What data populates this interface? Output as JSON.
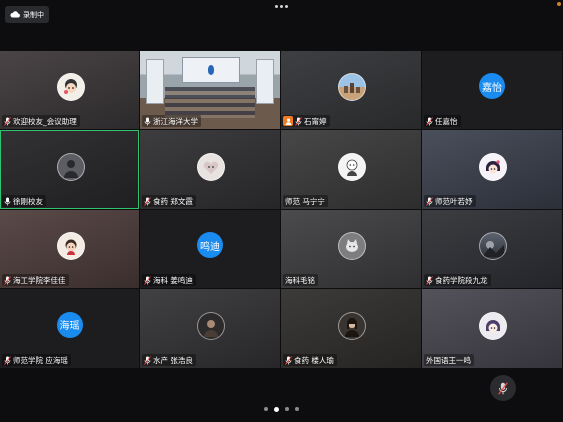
{
  "recording": {
    "label": "录制中"
  },
  "colors": {
    "accent_green": "#2fc46d",
    "text_avatar_blue": "#1a8cf0",
    "host_badge": "#ee7a21",
    "background": "#0d0d0f"
  },
  "participants": [
    {
      "name": "欢迎校友_会议助理",
      "avatar": "cartoon-avatar-icon",
      "mic": "muted"
    },
    {
      "name": "浙江海洋大学",
      "avatar": "room-video",
      "mic": "on"
    },
    {
      "name": "石甯婷",
      "avatar": "cityscape-avatar-icon",
      "mic": "muted",
      "host": true
    },
    {
      "name": "任嘉怡",
      "text_avatar": "嘉怡",
      "mic": "muted"
    },
    {
      "name": "徐刚校友",
      "avatar": "person-avatar-icon",
      "mic": "on",
      "selected": true
    },
    {
      "name": "食药 郑文霞",
      "avatar": "cartoon-avatar-icon",
      "mic": "muted"
    },
    {
      "name": "师范 马宁宁",
      "avatar": "cartoon-avatar-icon",
      "mic": "none"
    },
    {
      "name": "师范叶若妤",
      "avatar": "cartoon-avatar-icon",
      "mic": "muted"
    },
    {
      "name": "海工学院李佳佳",
      "avatar": "cartoon-avatar-icon",
      "mic": "muted"
    },
    {
      "name": "海科 姜鸣迪",
      "text_avatar": "鸣迪",
      "mic": "muted"
    },
    {
      "name": "海科毛铭",
      "avatar": "animal-avatar-icon",
      "mic": "none"
    },
    {
      "name": "食药学院段九龙",
      "avatar": "photo-avatar-icon",
      "mic": "muted"
    },
    {
      "name": "师范学院 应海瑶",
      "text_avatar": "海瑶",
      "mic": "muted"
    },
    {
      "name": "水产 张浩良",
      "avatar": "person-avatar-icon",
      "mic": "muted"
    },
    {
      "name": "食药 楼人瑜",
      "avatar": "person-avatar-icon",
      "mic": "muted"
    },
    {
      "name": "外国语王一鸣",
      "avatar": "cartoon-avatar-icon",
      "mic": "none"
    }
  ],
  "pagination": {
    "pages": 4,
    "current": 2
  }
}
